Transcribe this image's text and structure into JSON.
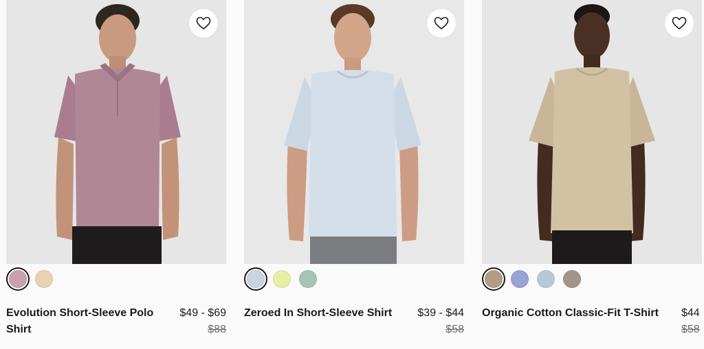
{
  "products": [
    {
      "name": "Evolution Short-Sleeve Polo Shirt",
      "price": "$49 - $69",
      "original_price": "$88",
      "swatches": [
        "#c9a0ad",
        "#e8d2b1"
      ],
      "selected_swatch": 0,
      "image_subject": "man in mauve polo shirt"
    },
    {
      "name": "Zeroed In Short-Sleeve Shirt",
      "price": "$39 - $44",
      "original_price": "$58",
      "swatches": [
        "#c8d4de",
        "#e5f0a6",
        "#a5c4b8"
      ],
      "selected_swatch": 0,
      "image_subject": "man in light blue t-shirt"
    },
    {
      "name": "Organic Cotton Classic-Fit T-Shirt",
      "price": "$44",
      "original_price": "$58",
      "swatches": [
        "#b39c86",
        "#9aa3d6",
        "#b9c8d9",
        "#a19488"
      ],
      "selected_swatch": 0,
      "image_subject": "man in beige t-shirt"
    }
  ],
  "icons": {
    "favorite": "heart-icon"
  }
}
